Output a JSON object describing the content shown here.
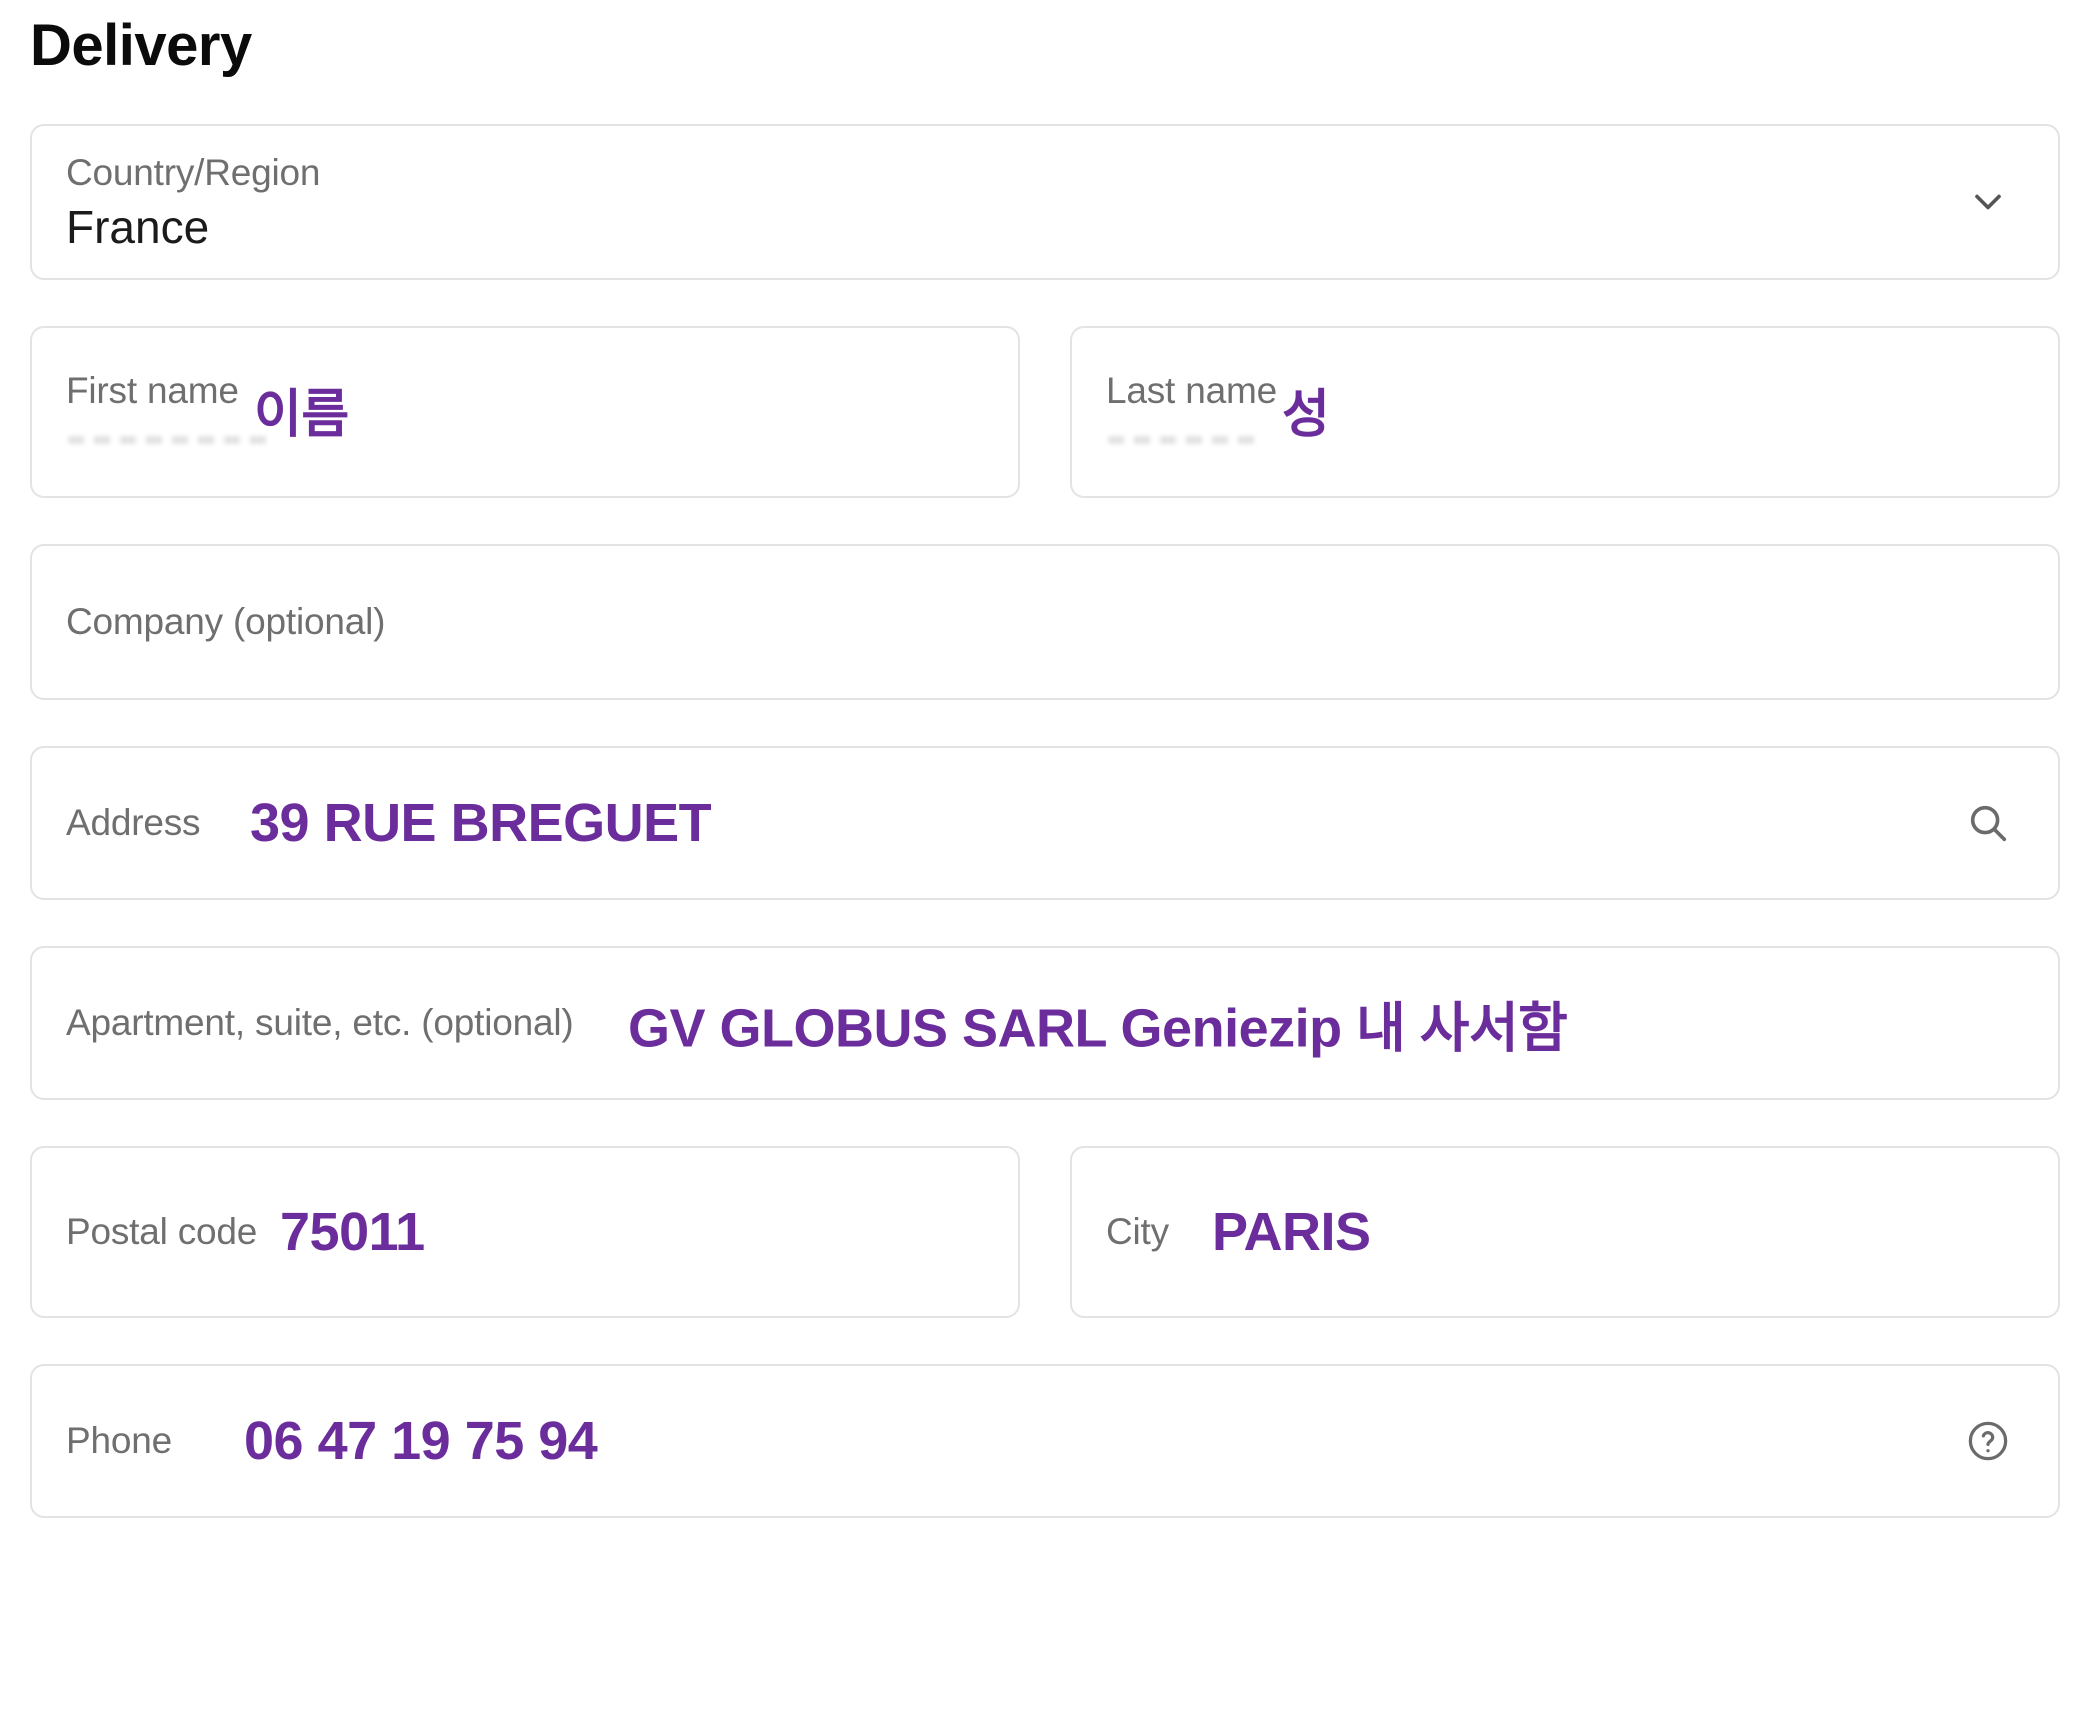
{
  "title": "Delivery",
  "accent_purple": "#6B2D9B",
  "label_gray": "#6F6F6F",
  "border_gray": "#E3E3E3",
  "fields": {
    "country": {
      "label": "Country/Region",
      "value": "France",
      "icon": "chevron-down-icon"
    },
    "first_name": {
      "label": "First name",
      "value": "",
      "annotation": "이름"
    },
    "last_name": {
      "label": "Last name",
      "value": "",
      "annotation": "성"
    },
    "company": {
      "label": "Company (optional)",
      "value": ""
    },
    "address": {
      "label": "Address",
      "annotation": "39 RUE BREGUET",
      "icon": "search-icon"
    },
    "apartment": {
      "label": "Apartment, suite, etc. (optional)",
      "annotation": "GV GLOBUS SARL Geniezip 내 사서함"
    },
    "postal_code": {
      "label": "Postal code",
      "annotation": "75011"
    },
    "city": {
      "label": "City",
      "annotation": "PARIS"
    },
    "phone": {
      "label": "Phone",
      "annotation": "06 47 19 75 94",
      "icon": "help-circle-icon"
    }
  }
}
